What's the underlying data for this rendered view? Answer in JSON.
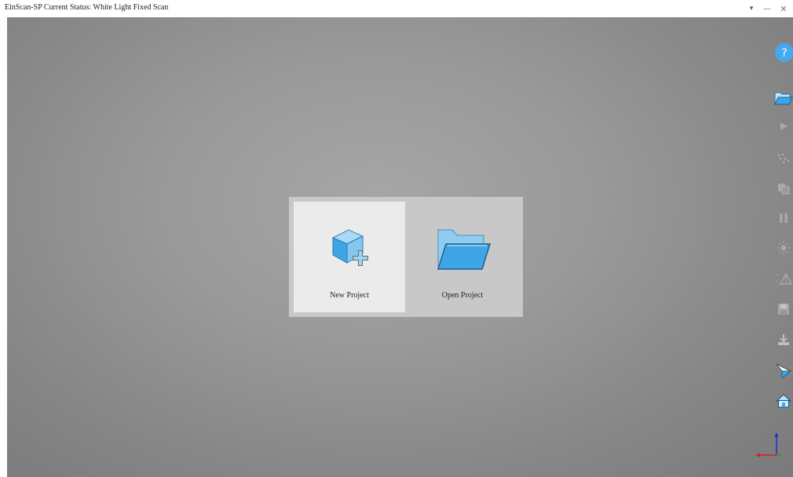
{
  "window": {
    "title": "EinScan-SP Current Status: White Light Fixed Scan",
    "controls": {
      "dropdown_glyph": "▾",
      "minimize_glyph": "—",
      "close_glyph": "✕"
    }
  },
  "start_dialog": {
    "new_project_label": "New Project",
    "open_project_label": "Open Project",
    "new_project_icon": "cube-plus-icon",
    "open_project_icon": "open-folder-icon"
  },
  "right_toolbar": {
    "items": [
      {
        "name": "help",
        "icon": "help-icon",
        "glyph": "?",
        "enabled": true
      },
      {
        "name": "open",
        "icon": "folder-icon",
        "enabled": true
      },
      {
        "name": "play",
        "icon": "play-icon",
        "enabled": false
      },
      {
        "name": "point-cloud",
        "icon": "points-icon",
        "enabled": false
      },
      {
        "name": "copy",
        "icon": "copy-icon",
        "enabled": false
      },
      {
        "name": "pause",
        "icon": "pause-icon",
        "enabled": false
      },
      {
        "name": "brightness",
        "icon": "sun-icon",
        "enabled": false
      },
      {
        "name": "mesh",
        "icon": "mesh-icon",
        "enabled": false
      },
      {
        "name": "save",
        "icon": "save-icon",
        "enabled": false
      },
      {
        "name": "export",
        "icon": "export-icon",
        "enabled": false
      },
      {
        "name": "measure",
        "icon": "measure-icon",
        "enabled": true
      },
      {
        "name": "home",
        "icon": "home-icon",
        "enabled": true
      }
    ]
  },
  "colors": {
    "accent_blue": "#3ea6e6",
    "help_blue": "#46a8ee",
    "panel_bg": "#c8c8c8",
    "card_selected": "#ebebeb"
  }
}
